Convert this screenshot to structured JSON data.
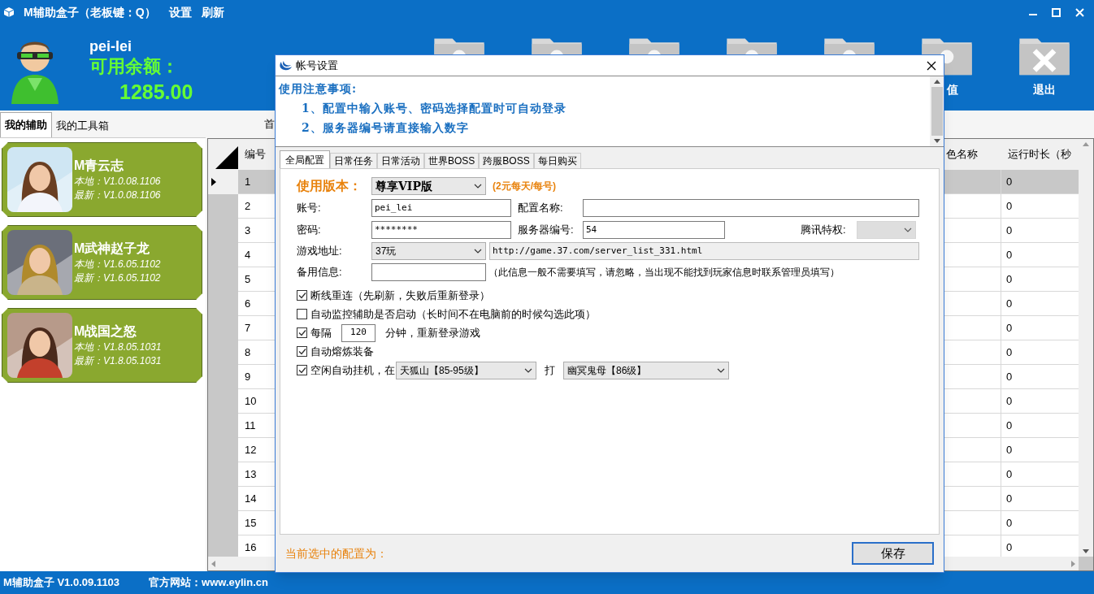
{
  "window": {
    "title": "M辅助盒子（老板键：Q）",
    "menu": [
      "设置",
      "刷新"
    ]
  },
  "user": {
    "name": "pei-lei",
    "balance_label": "可用余额：",
    "balance": "1285.00"
  },
  "toolbar": [
    {
      "kind": "folder"
    },
    {
      "kind": "folder"
    },
    {
      "kind": "folder"
    },
    {
      "kind": "folder"
    },
    {
      "kind": "folder"
    },
    {
      "kind": "folder",
      "label": "值"
    },
    {
      "kind": "exit",
      "label": "退出"
    }
  ],
  "left_tabs": [
    {
      "label": "我的辅助",
      "selected": true
    },
    {
      "label": "我的工具箱",
      "selected": false
    }
  ],
  "games": [
    {
      "name": "M青云志",
      "local": "本地：V1.0.08.1106",
      "latest": "最新：V1.0.08.1106"
    },
    {
      "name": "M武神赵子龙",
      "local": "本地：V1.6.05.1102",
      "latest": "最新：V1.6.05.1102"
    },
    {
      "name": "M战国之怒",
      "local": "本地：V1.8.05.1031",
      "latest": "最新：V1.8.05.1031"
    }
  ],
  "right_tab": "首",
  "grid": {
    "columns": [
      "编号",
      "色名称",
      "运行时长（秒"
    ],
    "rows": [
      {
        "id": "1",
        "runtime": "0",
        "selected": true
      },
      {
        "id": "2",
        "runtime": "0",
        "selected": false
      },
      {
        "id": "3",
        "runtime": "0",
        "selected": false
      },
      {
        "id": "4",
        "runtime": "0",
        "selected": false
      },
      {
        "id": "5",
        "runtime": "0",
        "selected": false
      },
      {
        "id": "6",
        "runtime": "0",
        "selected": false
      },
      {
        "id": "7",
        "runtime": "0",
        "selected": false
      },
      {
        "id": "8",
        "runtime": "0",
        "selected": false
      },
      {
        "id": "9",
        "runtime": "0",
        "selected": false
      },
      {
        "id": "10",
        "runtime": "0",
        "selected": false
      },
      {
        "id": "11",
        "runtime": "0",
        "selected": false
      },
      {
        "id": "12",
        "runtime": "0",
        "selected": false
      },
      {
        "id": "13",
        "runtime": "0",
        "selected": false
      },
      {
        "id": "14",
        "runtime": "0",
        "selected": false
      },
      {
        "id": "15",
        "runtime": "0",
        "selected": false
      },
      {
        "id": "16",
        "runtime": "0",
        "selected": false
      }
    ]
  },
  "dialog": {
    "title": "帐号设置",
    "notes": [
      "使用注意事项:",
      "1、配置中输入账号、密码选择配置时可自动登录",
      "2、服务器编号请直接输入数字"
    ],
    "tabs": [
      {
        "label": "全局配置",
        "selected": true
      },
      {
        "label": "日常任务",
        "selected": false
      },
      {
        "label": "日常活动",
        "selected": false
      },
      {
        "label": "世界BOSS",
        "selected": false
      },
      {
        "label": "跨服BOSS",
        "selected": false
      },
      {
        "label": "每日购买",
        "selected": false
      }
    ],
    "version": {
      "label": "使用版本：",
      "value": "尊享VIP版",
      "note": "(2元每天/每号)"
    },
    "account": {
      "label": "账号:",
      "value": "pei_lei"
    },
    "config_name": {
      "label": "配置名称:"
    },
    "password": {
      "label": "密码:",
      "value": "********"
    },
    "server": {
      "label": "服务器编号:",
      "value": "54"
    },
    "tencent": {
      "label": "腾讯特权:",
      "disabled": true
    },
    "game_url": {
      "label": "游戏地址:",
      "platform": "37玩",
      "url": "http://game.37.com/server_list_331.html",
      "readonly": true
    },
    "backup": {
      "label": "备用信息:",
      "note": "（此信息一般不需要填写，请忽略，当出现不能找到玩家信息时联系管理员填写）"
    },
    "options": [
      {
        "kind": "plain",
        "label": "断线重连（先刷新，失败后重新登录）",
        "checked": true
      },
      {
        "kind": "plain",
        "label": "自动监控辅助是否启动（长时间不在电脑前的时候勾选此项）",
        "checked": false
      },
      {
        "kind": "interval",
        "label": "每隔",
        "value": "120",
        "suffix": "分钟，重新登录游戏",
        "checked": true
      },
      {
        "kind": "plain",
        "label": "自动熔炼装备",
        "checked": true
      },
      {
        "kind": "idle",
        "label": "空闲自动挂机，在",
        "map": "天狐山【85-95级】",
        "word": "打",
        "boss": "幽冥鬼母【86级】",
        "checked": true
      }
    ],
    "current_label": "当前选中的配置为：",
    "save": "保存"
  },
  "status_bar": [
    "M辅助盒子 V1.0.09.1103",
    "官方网站：www.eylin.cn"
  ]
}
